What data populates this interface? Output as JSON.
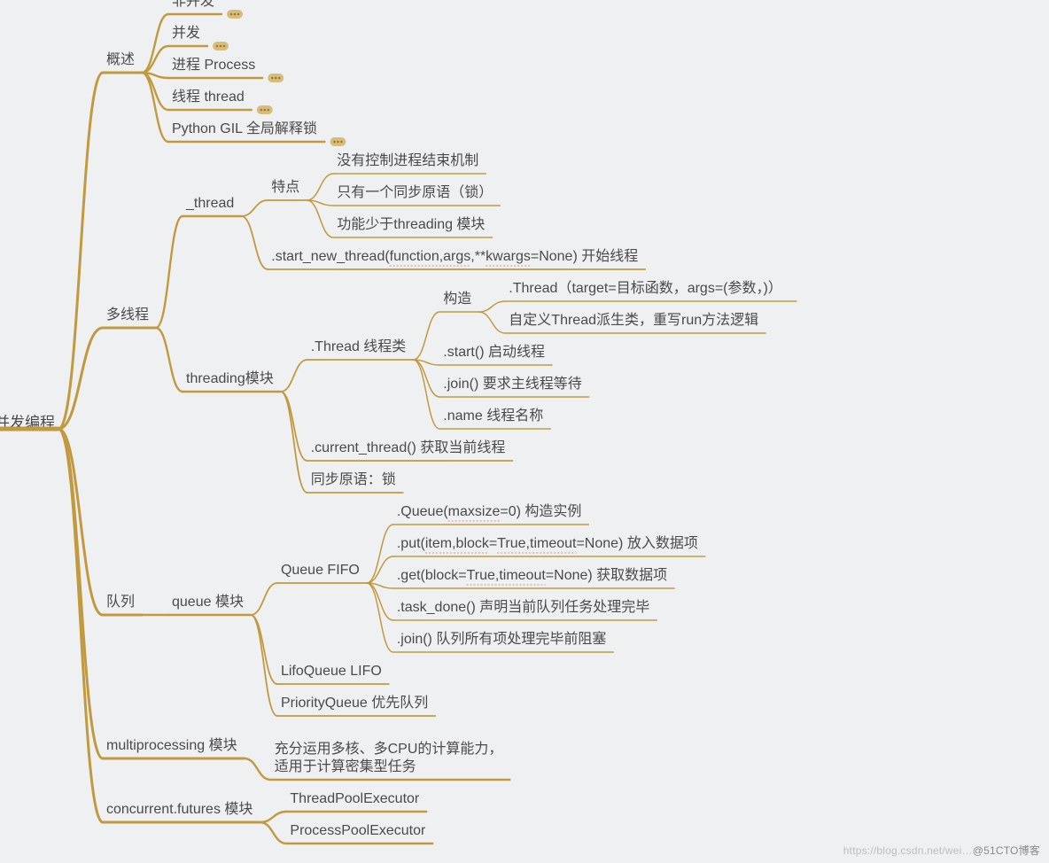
{
  "root": "并发编程",
  "watermark_faint": "https://blog.csdn.net/wei…",
  "watermark_bold": "@51CTO博客",
  "colors": {
    "branch": "#c19a3f",
    "text": "#4a4a4a",
    "badge_bg": "#d7bd7c",
    "badge_dots": "#a07a2a",
    "spell": "#e08a8a"
  },
  "children": [
    {
      "label": "概述",
      "collapsed": false,
      "children": [
        {
          "label": "非并发",
          "has_more": true
        },
        {
          "label": "并发",
          "has_more": true
        },
        {
          "label": "进程 Process",
          "has_more": true
        },
        {
          "label": "线程 thread",
          "has_more": true
        },
        {
          "label": "Python GIL 全局解释锁",
          "has_more": true
        }
      ]
    },
    {
      "label": "多线程",
      "children": [
        {
          "label": "_thread",
          "children": [
            {
              "label": "特点",
              "children": [
                {
                  "label": "没有控制进程结束机制"
                },
                {
                  "label": "只有一个同步原语（锁）"
                },
                {
                  "label": "功能少于threading 模块"
                }
              ]
            },
            {
              "label": ".start_new_thread(function,args,**kwargs=None) 开始线程",
              "spellcheck_words": [
                "function,args",
                "kwargs"
              ]
            }
          ]
        },
        {
          "label": "threading模块",
          "children": [
            {
              "label": ".Thread 线程类",
              "children": [
                {
                  "label": "构造",
                  "children": [
                    {
                      "label": ".Thread（target=目标函数，args=(参数，)）"
                    },
                    {
                      "label": "自定义Thread派生类，重写run方法逻辑"
                    }
                  ]
                },
                {
                  "label": ".start() 启动线程"
                },
                {
                  "label": ".join() 要求主线程等待"
                },
                {
                  "label": ".name 线程名称"
                }
              ]
            },
            {
              "label": ".current_thread() 获取当前线程"
            },
            {
              "label": "同步原语：锁"
            }
          ]
        }
      ]
    },
    {
      "label": "队列",
      "children": [
        {
          "label": "queue 模块",
          "children": [
            {
              "label": "Queue FIFO",
              "children": [
                {
                  "label": ".Queue(maxsize=0) 构造实例",
                  "spellcheck_words": [
                    "maxsize"
                  ]
                },
                {
                  "label": ".put(item,block=True,timeout=None) 放入数据项",
                  "spellcheck_words": [
                    "item,block",
                    "True,timeout"
                  ]
                },
                {
                  "label": ".get(block=True,timeout=None) 获取数据项",
                  "spellcheck_words": [
                    "True,timeout"
                  ]
                },
                {
                  "label": ".task_done() 声明当前队列任务处理完毕"
                },
                {
                  "label": ".join() 队列所有项处理完毕前阻塞"
                }
              ]
            },
            {
              "label": "LifoQueue LIFO"
            },
            {
              "label": "PriorityQueue 优先队列"
            }
          ]
        }
      ]
    },
    {
      "label": "multiprocessing 模块",
      "children": [
        {
          "label": "充分运用多核、多CPU的计算能力，适用于计算密集型任务",
          "wrap": true
        }
      ]
    },
    {
      "label": "concurrent.futures 模块",
      "children": [
        {
          "label": "ThreadPoolExecutor"
        },
        {
          "label": "ProcessPoolExecutor"
        }
      ]
    }
  ]
}
